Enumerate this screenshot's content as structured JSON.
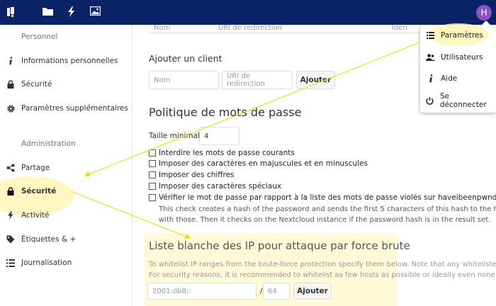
{
  "header": {
    "logo_icon": "nextcloud-logo-icon",
    "apps": [
      "files-icon",
      "activity-icon",
      "gallery-icon"
    ],
    "avatar_letter": "H",
    "avatar_color": "#8b52c8",
    "background": "#0a2366"
  },
  "sidebar": {
    "personal_caption": "Personnel",
    "personal_items": [
      {
        "label": "Informations personnelles",
        "icon": "info-icon"
      },
      {
        "label": "Sécurité",
        "icon": "lock-icon"
      },
      {
        "label": "Paramètres supplémentaires",
        "icon": "gear-icon"
      }
    ],
    "admin_caption": "Administration",
    "admin_items": [
      {
        "label": "Partage",
        "icon": "share-icon"
      },
      {
        "label": "Sécurité",
        "icon": "lock-icon",
        "active": true
      },
      {
        "label": "Activité",
        "icon": "activity-icon"
      },
      {
        "label": "Étiquettes & +",
        "icon": "tag-icon"
      },
      {
        "label": "Journalisation",
        "icon": "list-icon"
      }
    ]
  },
  "main": {
    "table_headers": [
      "Nom",
      "URI de redirection",
      "Iden"
    ],
    "add_client": {
      "label": "Ajouter un client",
      "name_placeholder": "Nom",
      "uri_placeholder": "URI de redirection",
      "add_button": "Ajouter"
    },
    "password_policy": {
      "title": "Politique de mots de passe",
      "min_length_label": "Taille minimale",
      "min_length_value": "4",
      "options": [
        "Interdire les mots de passe courants",
        "Imposer des caractères en majuscules et en minuscules",
        "Imposer des chiffres",
        "Imposer des caractères spéciaux",
        "Vérifier le mot de passe par rapport à la liste des mots de passe violés sur haveibeenpwnd. com"
      ],
      "hibp_description_1": "This check creates a hash of the password and sends the first 5 characters of this hash to the haveibeenp",
      "hibp_description_2": "with those. Then it checks on the Nextcloud instance if the password hash is in the result set."
    },
    "ip_whitelist": {
      "title": "Liste blanche des IP pour attaque par force brute",
      "desc_1": "To whitelist IP ranges from the brute-force protection specify them below. Note that any whitelisted IP can p",
      "desc_2": "For security reasons, it is recommended to whitelist as few hosts as possible or ideally even none at all.",
      "ip_placeholder": "2001:db8::",
      "slash": "/",
      "mask_placeholder": "64",
      "add_button": "Ajouter"
    }
  },
  "dropdown": {
    "items": [
      {
        "label": "Paramètres",
        "icon": "settings-list-icon"
      },
      {
        "label": "Utilisateurs",
        "icon": "users-icon"
      },
      {
        "label": "Aide",
        "icon": "info-icon"
      },
      {
        "label": "Se déconnecter",
        "icon": "power-icon"
      }
    ]
  },
  "highlight_color": "#fff6b4"
}
